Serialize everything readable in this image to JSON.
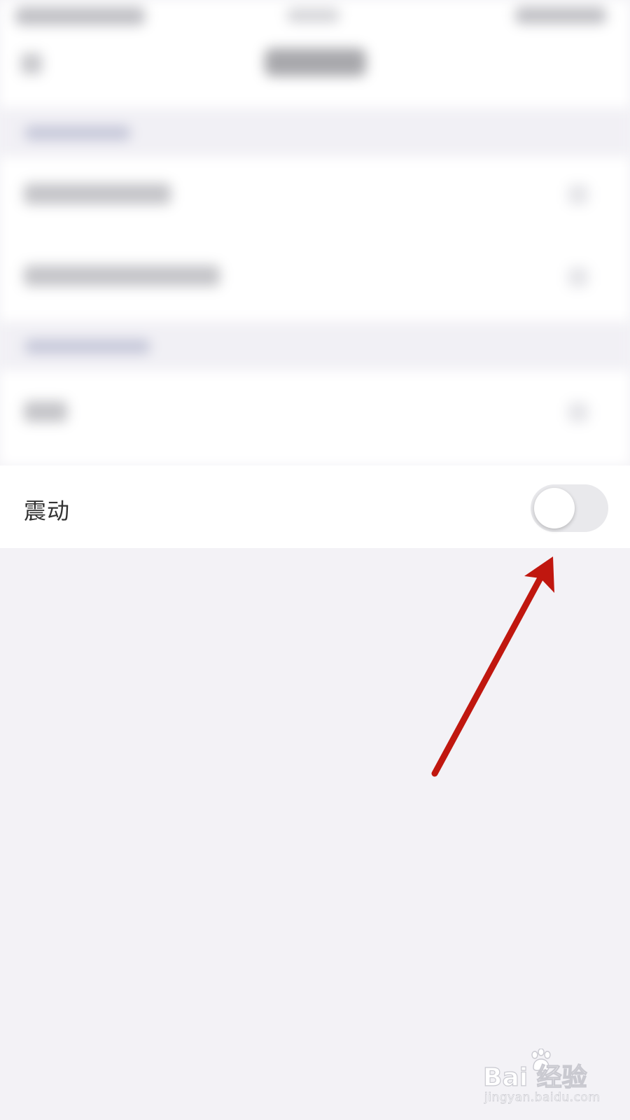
{
  "settings": {
    "vibrate_label": "震动",
    "vibrate_enabled": false
  },
  "annotation": {
    "arrow_color": "#c0170f"
  },
  "watermark": {
    "brand": "Bai  经验",
    "url": "jingyan.baidu.com"
  },
  "colors": {
    "page_background": "#f3f2f6",
    "card_background": "#ffffff",
    "toggle_off_track": "#e9e9ec"
  }
}
